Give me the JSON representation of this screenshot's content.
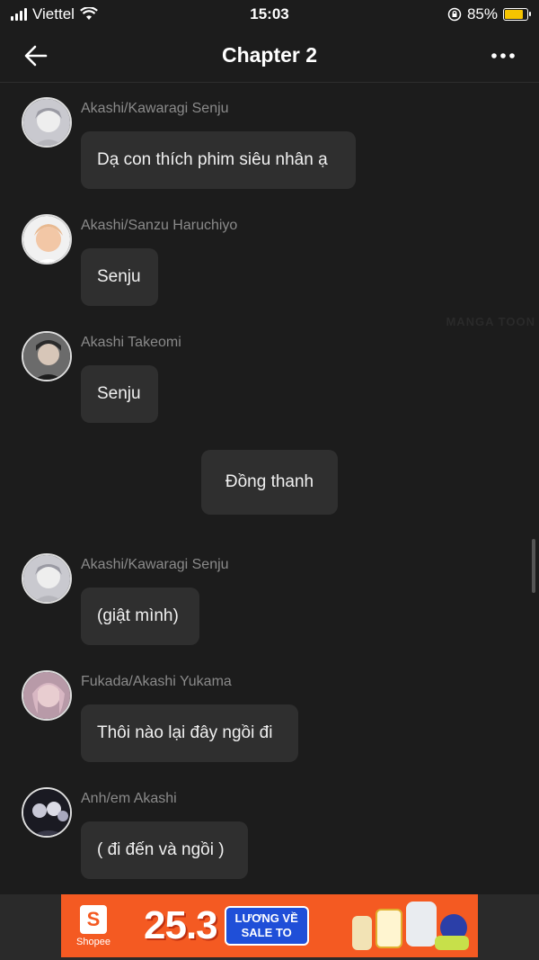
{
  "status_bar": {
    "carrier": "Viettel",
    "time": "15:03",
    "battery": "85%",
    "battery_level": 0.85
  },
  "header": {
    "title": "Chapter 2",
    "back_icon": "arrow-left-icon",
    "menu_icon": "more-horizontal-icon"
  },
  "messages": [
    {
      "sender": "Akashi/Kawaragi Senju",
      "text": "Dạ con thích phim siêu nhân ạ"
    },
    {
      "sender": "Akashi/Sanzu Haruchiyo",
      "text": "Senju"
    },
    {
      "sender": "Akashi Takeomi",
      "text": "Senju"
    },
    {
      "sender": "",
      "text": "Đồng thanh"
    },
    {
      "sender": "Akashi/Kawaragi Senju",
      "text": "(giật mình)"
    },
    {
      "sender": "Fukada/Akashi Yukama",
      "text": "Thôi nào lại đây ngồi đi"
    },
    {
      "sender": "Anh/em Akashi",
      "text": "( đi đến và ngồi )"
    }
  ],
  "ad": {
    "brand": "Shopee",
    "headline": "25.3",
    "tag_line1": "LƯƠNG VỀ",
    "tag_line2": "SALE TO"
  },
  "colors": {
    "background": "#1c1c1c",
    "bubble": "#2f2f2f",
    "ad_orange": "#f45a22",
    "battery": "#f5c400"
  }
}
